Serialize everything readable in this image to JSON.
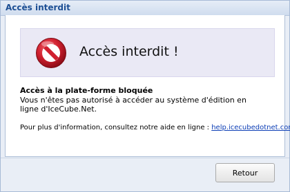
{
  "dialog": {
    "title": "Accès interdit",
    "title_color": "#1d4f94"
  },
  "banner": {
    "icon": "stop-icon",
    "icon_color": "#c8102e",
    "title": "Accès interdit !"
  },
  "message": {
    "heading": "Accès à la plate-forme bloquée",
    "body": "Vous n'êtes pas autorisé à accéder au système d'édition en ligne d'IceCube.Net.",
    "info_prefix": "Pour plus d'information, consultez notre aide en ligne : ",
    "help_link": "help.icecubedotnet.com",
    "link_color": "#0a3cb5"
  },
  "footer": {
    "back_button_label": "Retour"
  }
}
